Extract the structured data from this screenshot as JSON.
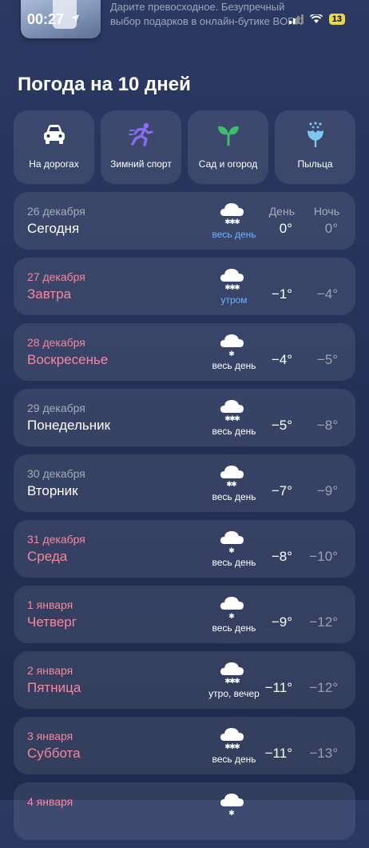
{
  "status_bar": {
    "time": "00:27",
    "ad_line1": "Дарите превосходное. Безупречный",
    "ad_line2": "выбор подарков в онлайн-бутике BORK",
    "battery": "13"
  },
  "page_title": "Погода на 10 дней",
  "categories": [
    {
      "label": "На дорогах",
      "icon": "car-icon"
    },
    {
      "label": "Зимний спорт",
      "icon": "runner-icon"
    },
    {
      "label": "Сад и огород",
      "icon": "sprout-icon"
    },
    {
      "label": "Пыльца",
      "icon": "flower-icon"
    }
  ],
  "column_headers": {
    "day": "День",
    "night": "Ночь"
  },
  "days": [
    {
      "date": "26 декабря",
      "name": "Сегодня",
      "condition": "весь день",
      "day_temp": "0°",
      "night_temp": "0°",
      "holiday": false,
      "icon": "snow-cloud-icon"
    },
    {
      "date": "27 декабря",
      "name": "Завтра",
      "condition": "утром",
      "day_temp": "−1°",
      "night_temp": "−4°",
      "holiday": true,
      "icon": "snow-cloud-icon"
    },
    {
      "date": "28 декабря",
      "name": "Воскресенье",
      "condition": "весь день",
      "day_temp": "−4°",
      "night_temp": "−5°",
      "holiday": true,
      "icon": "snow-cloud-icon"
    },
    {
      "date": "29 декабря",
      "name": "Понедельник",
      "condition": "весь день",
      "day_temp": "−5°",
      "night_temp": "−8°",
      "holiday": false,
      "icon": "snow-cloud-icon"
    },
    {
      "date": "30 декабря",
      "name": "Вторник",
      "condition": "весь день",
      "day_temp": "−7°",
      "night_temp": "−9°",
      "holiday": false,
      "icon": "snow-cloud-icon"
    },
    {
      "date": "31 декабря",
      "name": "Среда",
      "condition": "весь день",
      "day_temp": "−8°",
      "night_temp": "−10°",
      "holiday": true,
      "icon": "snow-cloud-icon"
    },
    {
      "date": "1 января",
      "name": "Четверг",
      "condition": "весь день",
      "day_temp": "−9°",
      "night_temp": "−12°",
      "holiday": true,
      "icon": "snow-cloud-icon"
    },
    {
      "date": "2 января",
      "name": "Пятница",
      "condition": "утро, вечер",
      "day_temp": "−11°",
      "night_temp": "−12°",
      "holiday": true,
      "icon": "snow-cloud-icon"
    },
    {
      "date": "3 января",
      "name": "Суббота",
      "condition": "весь день",
      "day_temp": "−11°",
      "night_temp": "−13°",
      "holiday": true,
      "icon": "snow-cloud-icon"
    },
    {
      "date": "4 января",
      "name": "",
      "condition": "",
      "day_temp": "",
      "night_temp": "",
      "holiday": true,
      "icon": "snow-cloud-icon"
    }
  ],
  "colors": {
    "holiday": "#f2899d",
    "accent_blue": "#6fb2ff",
    "sport_purple": "#8b6cf0",
    "sprout_green": "#3bbf6a",
    "flower_blue": "#7fc6f0"
  }
}
